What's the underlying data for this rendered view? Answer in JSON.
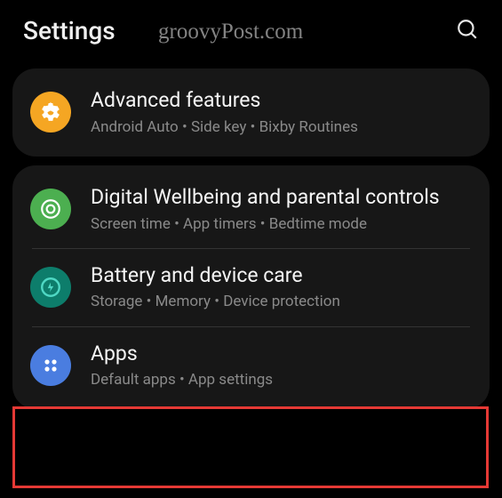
{
  "header": {
    "title": "Settings",
    "watermark": "groovyPost.com"
  },
  "groups": [
    {
      "items": [
        {
          "title": "Advanced features",
          "subtitle_parts": [
            "Android Auto",
            "Side key",
            "Bixby Routines"
          ]
        }
      ]
    },
    {
      "items": [
        {
          "title": "Digital Wellbeing and parental controls",
          "subtitle_parts": [
            "Screen time",
            "App timers",
            "Bedtime mode"
          ]
        },
        {
          "title": "Battery and device care",
          "subtitle_parts": [
            "Storage",
            "Memory",
            "Device protection"
          ]
        },
        {
          "title": "Apps",
          "subtitle_parts": [
            "Default apps",
            "App settings"
          ]
        }
      ]
    }
  ]
}
